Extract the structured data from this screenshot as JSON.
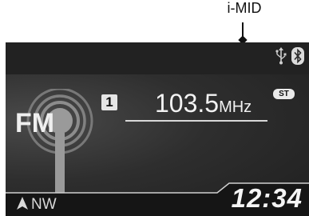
{
  "callout": {
    "label": "i-MID"
  },
  "status": {
    "icons": [
      "usb-icon",
      "bluetooth-icon"
    ]
  },
  "radio": {
    "band_logo": "FM",
    "preset": "1",
    "frequency": "103.5",
    "unit": "MHz",
    "stereo_badge": "ST"
  },
  "compass": {
    "direction": "NW"
  },
  "clock": {
    "time": "12:34"
  }
}
